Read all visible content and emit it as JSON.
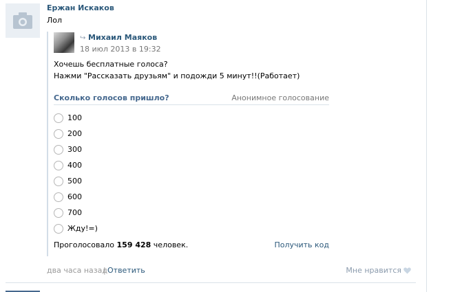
{
  "post": {
    "author": "Ержан Искаков",
    "text": "Лол",
    "avatar_icon": "camera-icon"
  },
  "repost": {
    "icon": "repost-arrow-icon",
    "author": "Михаил Маяков",
    "date": "18 июл 2013 в 19:32",
    "message_line1": "Хочешь бесплатные голоса?",
    "message_line2": "Нажми \"Рассказать друзьям\" и подожди 5 минут!!(Работает)"
  },
  "poll": {
    "title": "Сколько голосов пришло?",
    "type": "Анонимное голосование",
    "options": [
      "100",
      "200",
      "300",
      "400",
      "500",
      "600",
      "700",
      "Жду!=)"
    ],
    "total_prefix": "Проголосовало",
    "total_count": "159 428",
    "total_suffix": "человек.",
    "get_code": "Получить код"
  },
  "footer": {
    "time": "два часа назад",
    "separator": "|",
    "reply": "Ответить",
    "like": "Мне нравится",
    "like_icon": "heart-icon"
  },
  "colors": {
    "link": "#2b587a",
    "poll_title": "#45688e",
    "muted": "#777777",
    "divider": "#dae1e8"
  }
}
